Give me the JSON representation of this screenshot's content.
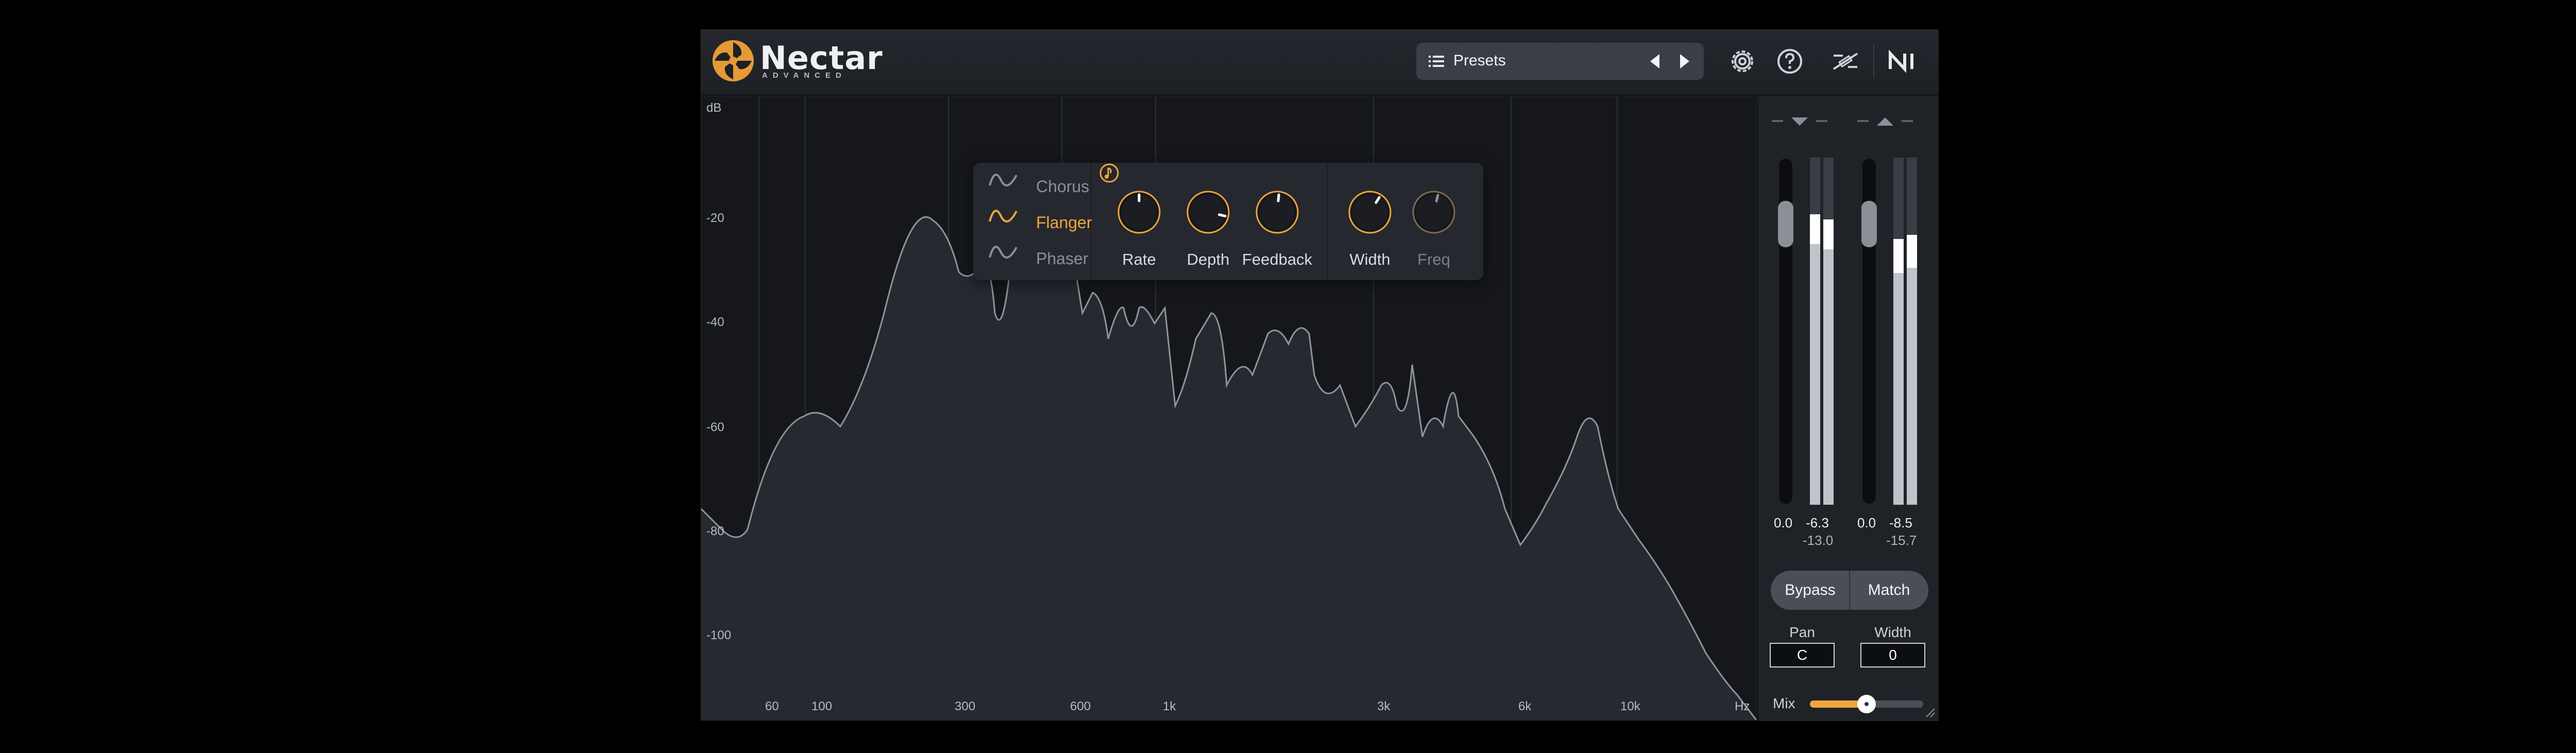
{
  "brand": {
    "name": "Nectar",
    "subtitle": "ADVANCED"
  },
  "presets": {
    "label": "Presets"
  },
  "header_icons": [
    "settings-icon",
    "help-icon",
    "signal-path-icon",
    "ni-logo"
  ],
  "spectrum": {
    "db_labels": [
      "dB",
      "-20",
      "-40",
      "-60",
      "-80",
      "-100"
    ],
    "hz_labels": [
      "60",
      "100",
      "300",
      "600",
      "1k",
      "3k",
      "6k",
      "10k",
      "Hz"
    ]
  },
  "modulation": {
    "modes": [
      {
        "label": "Chorus",
        "active": false
      },
      {
        "label": "Flanger",
        "active": true
      },
      {
        "label": "Phaser",
        "active": false
      }
    ],
    "knobs": [
      {
        "label": "Rate",
        "value_fraction": 0.5,
        "enabled": true
      },
      {
        "label": "Depth",
        "value_fraction": 0.88,
        "enabled": true
      },
      {
        "label": "Feedback",
        "value_fraction": 0.52,
        "enabled": true
      },
      {
        "label": "Width",
        "value_fraction": 0.62,
        "enabled": true
      },
      {
        "label": "Freq",
        "value_fraction": 0.55,
        "enabled": false
      }
    ],
    "accent_color": "#f0a63b"
  },
  "meters": {
    "input": {
      "gain": "0.0",
      "peak": "-6.3",
      "rms": "-13.0"
    },
    "output": {
      "gain": "0.0",
      "peak": "-8.5",
      "rms": "-15.7"
    }
  },
  "buttons": {
    "bypass": "Bypass",
    "match": "Match"
  },
  "pan": {
    "label": "Pan",
    "value": "C"
  },
  "width": {
    "label": "Width",
    "value": "0"
  },
  "mix": {
    "label": "Mix",
    "value_fraction": 0.5
  }
}
